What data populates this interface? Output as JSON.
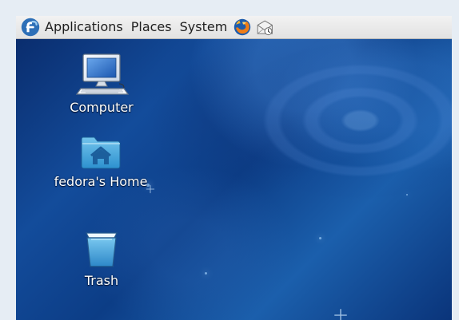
{
  "top_panel": {
    "menus": [
      {
        "label": "Applications"
      },
      {
        "label": "Places"
      },
      {
        "label": "System"
      }
    ],
    "launchers": [
      {
        "icon": "firefox-icon"
      },
      {
        "icon": "mail-clock-icon"
      }
    ]
  },
  "desktop": {
    "icons": [
      {
        "label": "Computer",
        "icon": "computer-icon"
      },
      {
        "label": "fedora's Home",
        "icon": "home-folder-icon"
      },
      {
        "label": "Trash",
        "icon": "trash-icon"
      }
    ]
  },
  "colors": {
    "panel_background": "#e6e6e6",
    "desktop_primary": "#0e3e86",
    "desktop_highlight": "#1b5fac",
    "frame_background": "#e6edf4"
  }
}
